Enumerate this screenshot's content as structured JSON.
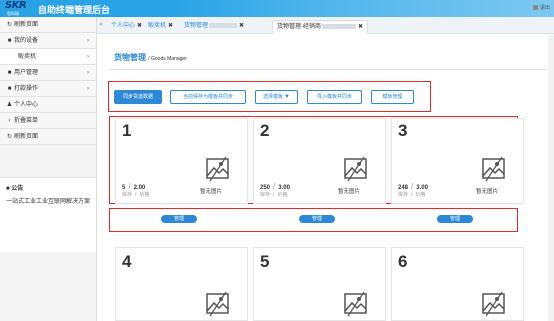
{
  "header": {
    "logo_text": "SKR",
    "logo_sub": "思科瑞",
    "title": "自助终端管理后台",
    "user_text": "退出"
  },
  "sidebar": {
    "items": [
      {
        "icon": "refresh-icon",
        "glyph": "↻",
        "label": "刷新页面",
        "arrow": ""
      },
      {
        "icon": "folder-icon",
        "glyph": "■",
        "label": "我的设备",
        "arrow": "›"
      },
      {
        "icon": "",
        "glyph": "",
        "label": "販卖机",
        "arrow": "›"
      },
      {
        "icon": "folder-icon",
        "glyph": "■",
        "label": "用户管理",
        "arrow": "›"
      },
      {
        "icon": "folder-icon",
        "glyph": "■",
        "label": "打款操作",
        "arrow": "›"
      },
      {
        "icon": "user-icon",
        "glyph": "♟",
        "label": "个人中心",
        "arrow": ""
      },
      {
        "icon": "chevron-left-icon",
        "glyph": "‹",
        "label": "折叠菜单",
        "arrow": ""
      },
      {
        "icon": "refresh-icon",
        "glyph": "↻",
        "label": "刷新页面",
        "arrow": ""
      }
    ],
    "notice_title": "公告",
    "notice_body": "一站式工业工业互联网解决方案"
  },
  "tabs": [
    {
      "label": "个人中心",
      "closable": true
    },
    {
      "label": "販卖机",
      "closable": true
    },
    {
      "label": "货物管理",
      "closable": true
    },
    {
      "label": "货物管理-经销商",
      "closable": true
    }
  ],
  "main": {
    "title": "货物管理",
    "title_en": "/ Goods Manager",
    "toolbar": {
      "sync_goods": "同步货道数据",
      "save_template": "当前保存为模板并同步",
      "select_template": "选择模板",
      "import_template": "导入模板并同步",
      "template_manage": "模板管理"
    },
    "cards": [
      {
        "num": "1",
        "stock": "5",
        "price": "2.00",
        "stock_label": "库存",
        "price_label": "价格",
        "no_image": "暂无图片",
        "manage": "管理"
      },
      {
        "num": "2",
        "stock": "250",
        "price": "3.00",
        "stock_label": "库存",
        "price_label": "价格",
        "no_image": "暂无图片",
        "manage": "管理"
      },
      {
        "num": "3",
        "stock": "248",
        "price": "3.00",
        "stock_label": "库存",
        "price_label": "价格",
        "no_image": "暂无图片",
        "manage": "管理"
      }
    ],
    "cards2": [
      {
        "num": "4"
      },
      {
        "num": "5"
      },
      {
        "num": "6"
      }
    ]
  },
  "colors": {
    "header_blue": "#2aa3e6",
    "primary": "#2d89d6",
    "highlight_red": "#e02b2b"
  }
}
